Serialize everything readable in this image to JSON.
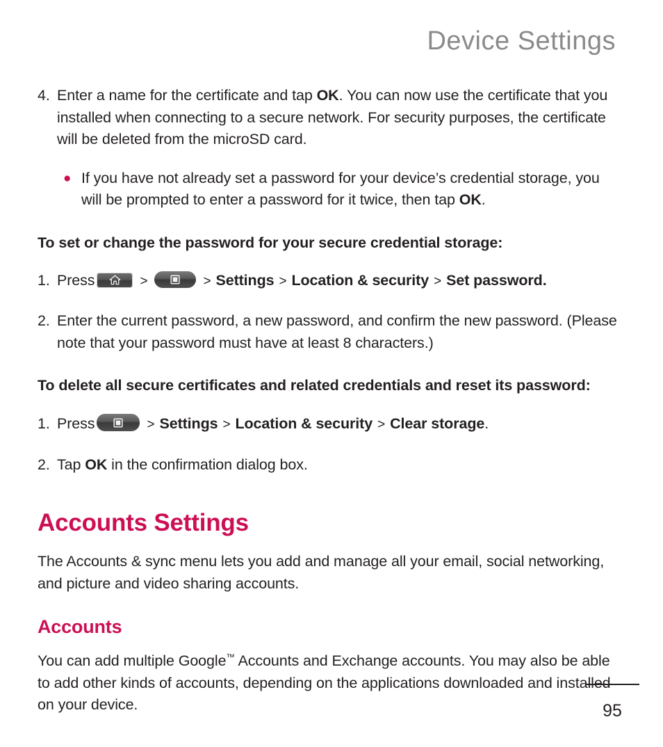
{
  "header": {
    "running_title": "Device Settings"
  },
  "content": {
    "step4": {
      "number": "4.",
      "text_part1": "Enter a name for the certificate and tap ",
      "bold1": "OK",
      "text_part2": ". You can now use the certificate that you installed when connecting to a secure network. For security purposes, the certificate will be deleted from the microSD card."
    },
    "bullet1": {
      "marker": "●",
      "text_part1": "If you have not already set a password for your device’s credential storage, you will be prompted to enter a password for it twice, then tap ",
      "bold1": "OK",
      "text_part2": "."
    },
    "heading_set_password": "To set or change the password for your secure credential storage:",
    "press_set_password": {
      "number": "1.",
      "press_label": "Press",
      "key1": "home-key",
      "sep1": ">",
      "key2": "menu-key",
      "sep2": ">",
      "crumb1": "Settings",
      "sep3": ">",
      "crumb2": "Location & security",
      "sep4": ">",
      "crumb3": "Set password",
      "period": "."
    },
    "step2_password": {
      "number": "2.",
      "text": "Enter the current password, a new password, and confirm the new password. (Please note that your password must have at least 8 characters.)"
    },
    "heading_delete_certs": "To delete all secure certificates and related credentials and reset its password:",
    "press_clear_storage": {
      "number": "1.",
      "press_label": "Press",
      "key1": "menu-key",
      "sep1": ">",
      "crumb1": "Settings",
      "sep2": ">",
      "crumb2": "Location & security",
      "sep3": ">",
      "crumb3": "Clear storage",
      "period": "."
    },
    "step2_tap_ok": {
      "number": "2.",
      "text_part1": "Tap ",
      "bold1": "OK",
      "text_part2": " in the confirmation dialog box."
    },
    "accounts_settings": {
      "heading": "Accounts Settings",
      "body": "The Accounts & sync menu lets you add and manage all your email, social networking, and picture and video sharing accounts."
    },
    "accounts": {
      "heading": "Accounts",
      "body_part1": "You can add multiple Google",
      "trademark": "™",
      "body_part2": " Accounts and Exchange accounts. You may also be able to add other kinds of accounts, depending on the applications downloaded and installed on your device."
    }
  },
  "footer": {
    "page_number": "95"
  },
  "colors": {
    "accent": "#cc0f54",
    "header_gray": "#8a8a8a",
    "body_text": "#231f20",
    "key_dark": "#3a3a3a"
  }
}
